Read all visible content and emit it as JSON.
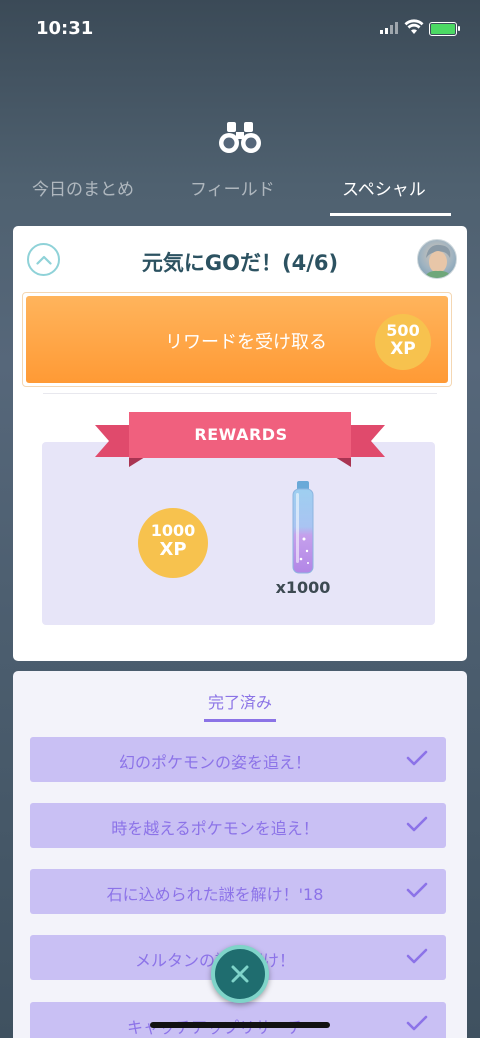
{
  "status_bar": {
    "time": "10:31"
  },
  "tabs": [
    {
      "label": "今日のまとめ",
      "active": false
    },
    {
      "label": "フィールド",
      "active": false
    },
    {
      "label": "スペシャル",
      "active": true
    }
  ],
  "card": {
    "title": "元気にGOだ！(4/6)",
    "claim_button_label": "リワードを受け取る",
    "claim_xp_amount": "500",
    "claim_xp_unit": "XP",
    "rewards_banner": "REWARDS",
    "reward_xp_amount": "1000",
    "reward_xp_unit": "XP",
    "reward_item_qty": "x1000"
  },
  "quests": {
    "tab_label": "完了済み",
    "items": [
      {
        "label": "幻のポケモンの姿を追え！"
      },
      {
        "label": "時を越えるポケモンを追え！"
      },
      {
        "label": "石に込められた謎を解け！'18"
      },
      {
        "label": "メルタンの謎を解け！"
      },
      {
        "label": "キャッチアップリサーチ"
      }
    ]
  },
  "colors": {
    "accent_orange": "#ff9a35",
    "xp_gold": "#f7c24e",
    "ribbon_pink": "#f0607e",
    "quest_purple": "#8c73e8",
    "quest_row_bg": "#c9c0f4",
    "close_teal": "#1f6d6f"
  }
}
